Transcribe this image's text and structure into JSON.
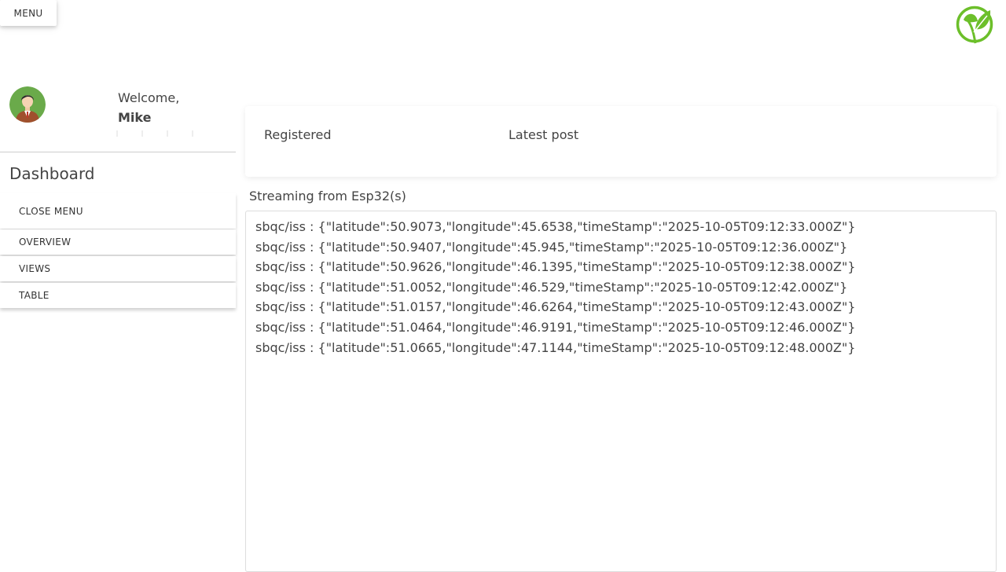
{
  "header": {
    "menu_label": "MENU"
  },
  "sidebar": {
    "welcome_label": "Welcome,",
    "user_name": "Mike",
    "title": "Dashboard",
    "close_menu_label": "CLOSE MENU",
    "items": [
      {
        "label": "OVERVIEW"
      },
      {
        "label": "VIEWS"
      },
      {
        "label": "TABLE"
      }
    ]
  },
  "stats": {
    "registered_label": "Registered",
    "latest_post_label": "Latest post"
  },
  "stream": {
    "label": "Streaming from Esp32(s)",
    "lines": [
      "sbqc/iss : {\"latitude\":50.9073,\"longitude\":45.6538,\"timeStamp\":\"2025-10-05T09:12:33.000Z\"}",
      "sbqc/iss : {\"latitude\":50.9407,\"longitude\":45.945,\"timeStamp\":\"2025-10-05T09:12:36.000Z\"}",
      "sbqc/iss : {\"latitude\":50.9626,\"longitude\":46.1395,\"timeStamp\":\"2025-10-05T09:12:38.000Z\"}",
      "sbqc/iss : {\"latitude\":51.0052,\"longitude\":46.529,\"timeStamp\":\"2025-10-05T09:12:42.000Z\"}",
      "sbqc/iss : {\"latitude\":51.0157,\"longitude\":46.6264,\"timeStamp\":\"2025-10-05T09:12:43.000Z\"}",
      "sbqc/iss : {\"latitude\":51.0464,\"longitude\":46.9191,\"timeStamp\":\"2025-10-05T09:12:46.000Z\"}",
      "sbqc/iss : {\"latitude\":51.0665,\"longitude\":47.1144,\"timeStamp\":\"2025-10-05T09:12:48.000Z\"}"
    ]
  },
  "icons": {
    "logo": "leaf-logo-icon",
    "avatar": "user-avatar"
  },
  "colors": {
    "logo_green": "#6cbf2a",
    "avatar_bg": "#6aaa4a"
  }
}
